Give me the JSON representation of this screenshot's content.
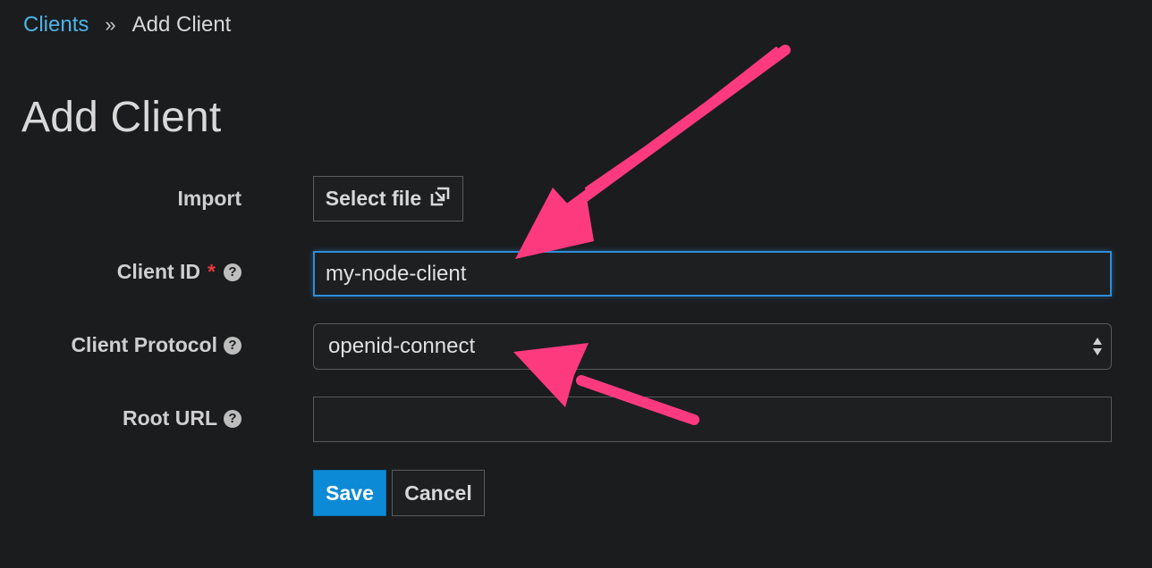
{
  "breadcrumb": {
    "parent": "Clients",
    "separator": "»",
    "current": "Add Client"
  },
  "page_title": "Add Client",
  "form": {
    "import": {
      "label": "Import",
      "button_label": "Select file",
      "button_icon": "import-box-arrow-icon"
    },
    "client_id": {
      "label": "Client ID",
      "required_mark": "*",
      "value": "my-node-client",
      "help_icon": "question-circle-icon"
    },
    "client_protocol": {
      "label": "Client Protocol",
      "selected": "openid-connect",
      "help_icon": "question-circle-icon"
    },
    "root_url": {
      "label": "Root URL",
      "value": "",
      "help_icon": "question-circle-icon"
    }
  },
  "actions": {
    "save_label": "Save",
    "cancel_label": "Cancel"
  },
  "colors": {
    "background": "#1b1c1e",
    "link": "#4db4e8",
    "primary_button": "#0d8ad6",
    "focus_border": "#2e8ddb",
    "required": "#e5383b",
    "annotation_arrow": "#fe3a7f"
  }
}
